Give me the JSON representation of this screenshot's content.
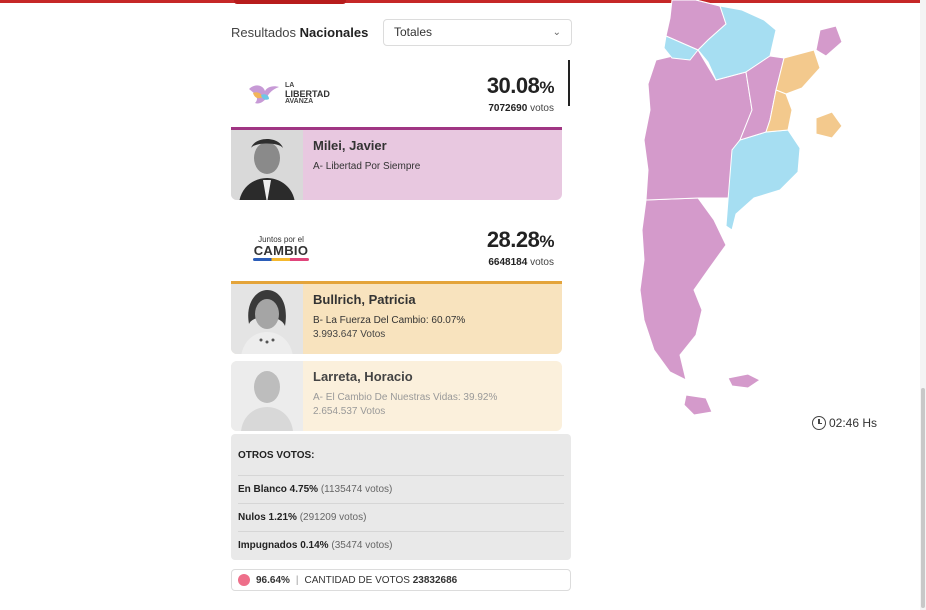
{
  "header": {
    "title_prefix": "Resultados",
    "title_bold": "Nacionales",
    "filter": {
      "selected": "Totales"
    }
  },
  "parties": [
    {
      "logo": {
        "line1": "LA",
        "line2": "LIBERTAD",
        "line3": "AVANZA"
      },
      "percent": "30.08",
      "percent_sign": "%",
      "votes_number": "7072690",
      "votes_label": "votos",
      "color": "#a03583",
      "candidates": [
        {
          "name": "Milei, Javier",
          "list": "A- Libertad Por Siempre",
          "votes": ""
        }
      ]
    },
    {
      "logo": {
        "line1": "Juntos por el",
        "line2": "CAMBIO"
      },
      "percent": "28.28",
      "percent_sign": "%",
      "votes_number": "6648184",
      "votes_label": "votos",
      "color": "#e4a43a",
      "candidates": [
        {
          "name": "Bullrich, Patricia",
          "list": "B- La Fuerza Del Cambio: 60.07%",
          "votes": "3.993.647 Votos"
        },
        {
          "name": "Larreta, Horacio",
          "list": "A- El Cambio De Nuestras Vidas: 39.92%",
          "votes": "2.654.537 Votos"
        }
      ]
    }
  ],
  "otros": {
    "title": "OTROS VOTOS:",
    "rows": [
      {
        "label": "En Blanco 4.75%",
        "detail": "(1135474 votos)"
      },
      {
        "label": "Nulos 1.21%",
        "detail": "(291209 votos)"
      },
      {
        "label": "Impugnados 0.14%",
        "detail": "(35474 votos)"
      }
    ]
  },
  "footer": {
    "progress": "96.64%",
    "separator": "|",
    "total_label": "CANTIDAD DE VOTOS",
    "total_value": "23832686",
    "dot_color": "#ee6f8a"
  },
  "map": {
    "colors": {
      "lla": "#d49acb",
      "uxp": "#a6def2",
      "jxc": "#f3c98d"
    },
    "time": "02:46 Hs"
  }
}
